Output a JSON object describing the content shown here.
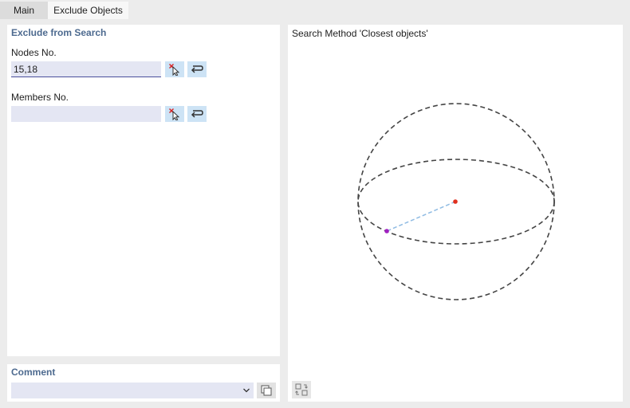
{
  "tabs": [
    {
      "label": "Main",
      "active": false
    },
    {
      "label": "Exclude Objects",
      "active": true
    }
  ],
  "exclude": {
    "title": "Exclude from Search",
    "nodes": {
      "label": "Nodes No.",
      "value": "15,18"
    },
    "members": {
      "label": "Members No.",
      "value": ""
    }
  },
  "comment": {
    "label": "Comment",
    "value": ""
  },
  "diagram": {
    "title": "Search Method 'Closest objects'"
  },
  "colors": {
    "accent": "#4d6a8f",
    "input_bg": "#e4e6f3",
    "button_bg": "#cde3f5",
    "center_point": "#e0301e",
    "object_point": "#a020c0",
    "radius_line": "#8fbbe3"
  },
  "icons": {
    "pick": "select-pointer-icon",
    "reset": "return-arrow-icon",
    "dropdown": "chevron-down-icon",
    "copy": "copy-icon",
    "view": "view-settings-icon"
  }
}
